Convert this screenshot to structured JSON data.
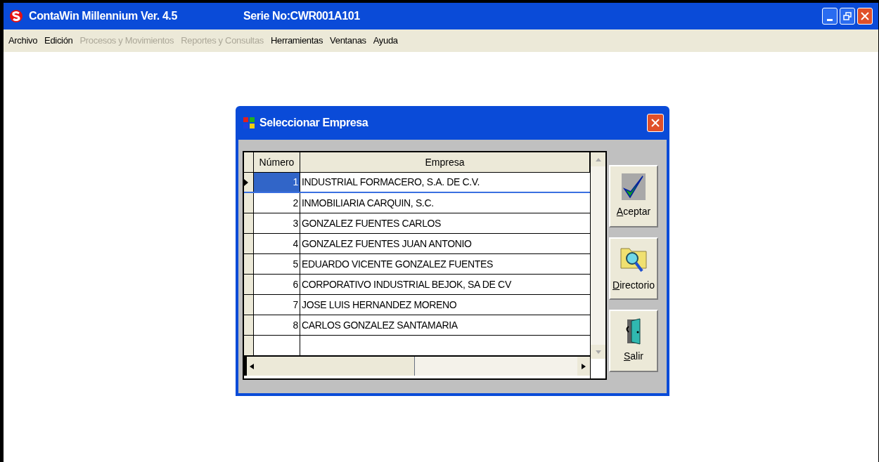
{
  "window": {
    "title": "ContaWin Millennium Ver. 4.5",
    "serial": "Serie No:CWR001A101"
  },
  "menu": [
    {
      "label": "Archivo",
      "disabled": false
    },
    {
      "label": "Edición",
      "disabled": false
    },
    {
      "label": "Procesos y Movimientos",
      "disabled": true
    },
    {
      "label": "Reportes y Consultas",
      "disabled": true
    },
    {
      "label": "Herramientas",
      "disabled": false
    },
    {
      "label": "Ventanas",
      "disabled": false
    },
    {
      "label": "Ayuda",
      "disabled": false
    }
  ],
  "dialog": {
    "title": "Seleccionar Empresa",
    "table": {
      "columns": [
        "Número",
        "Empresa"
      ],
      "rows": [
        {
          "number": "1",
          "company": "INDUSTRIAL FORMACERO, S.A. DE C.V.",
          "selected": true
        },
        {
          "number": "2",
          "company": "INMOBILIARIA CARQUIN, S.C.",
          "selected": false
        },
        {
          "number": "3",
          "company": "GONZALEZ FUENTES CARLOS",
          "selected": false
        },
        {
          "number": "4",
          "company": "GONZALEZ FUENTES JUAN ANTONIO",
          "selected": false
        },
        {
          "number": "5",
          "company": "EDUARDO VICENTE GONZALEZ FUENTES",
          "selected": false
        },
        {
          "number": "6",
          "company": "CORPORATIVO INDUSTRIAL BEJOK, SA DE CV",
          "selected": false
        },
        {
          "number": "7",
          "company": "JOSE LUIS HERNANDEZ MORENO",
          "selected": false
        },
        {
          "number": "8",
          "company": "CARLOS GONZALEZ SANTAMARIA",
          "selected": false
        }
      ]
    },
    "buttons": [
      {
        "label": "Aceptar",
        "kind": "accept"
      },
      {
        "label": "Directorio",
        "kind": "directory"
      },
      {
        "label": "Salir",
        "kind": "exit"
      }
    ]
  }
}
